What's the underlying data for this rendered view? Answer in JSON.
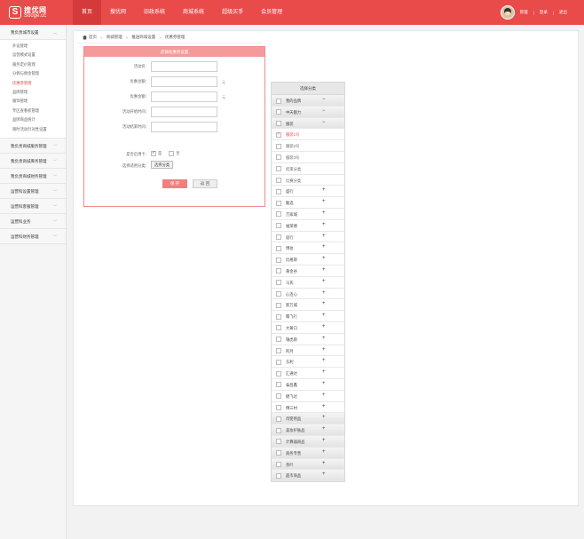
{
  "logo": {
    "mark": "S",
    "title": "搜优网",
    "domain": "Sooge.cc"
  },
  "nav": [
    "首页",
    "搜优网",
    "旧政系统",
    "商城系统",
    "超级买手",
    "会员管理"
  ],
  "user": {
    "name": "管理",
    "links": [
      "登录",
      "退出"
    ]
  },
  "sidebar": {
    "sections": [
      {
        "title": "我负责城市设置",
        "expanded": true,
        "items": [
          "外设管理",
          "运营模式设置",
          "服务定价管理",
          "分佣与佣金管理",
          "优惠券管理",
          "品牌管理",
          "服饰管理",
          "专区查看权管理",
          "品牌商品统计",
          "限时活动针对性设置"
        ]
      },
      {
        "title": "我负责商城服务管理"
      },
      {
        "title": "我负责商城库务管理"
      },
      {
        "title": "我负责商城财务管理"
      },
      {
        "title": "运营科设置管理"
      },
      {
        "title": "运营科客服管理"
      },
      {
        "title": "运营科业务"
      },
      {
        "title": "运营科财务管理"
      }
    ]
  },
  "breadcrumb": [
    "首页",
    "商城管理",
    "推送商城设置",
    "优惠券管理"
  ],
  "form": {
    "header": "店铺优惠券设置",
    "fields": [
      {
        "label": "活动名：",
        "value": "",
        "unit": ""
      },
      {
        "label": "优惠总额：",
        "value": "",
        "unit": "元"
      },
      {
        "label": "优惠金额：",
        "value": "",
        "unit": "元"
      },
      {
        "label": "活动开始时间：",
        "value": "",
        "unit": ""
      },
      {
        "label": "活动结束时间：",
        "value": "",
        "unit": ""
      }
    ],
    "online": {
      "label": "是否启用卡：",
      "yes": "是",
      "no": "否",
      "selected": "是"
    },
    "category": {
      "label": "选择适用分类：",
      "button": "选择分类"
    },
    "save": "保 存",
    "back": "返 回"
  },
  "categories": {
    "header": "选择分类",
    "items": [
      {
        "name": "我的品牌",
        "type": "group",
        "toggle": "−",
        "checked": false
      },
      {
        "name": "中天魅力",
        "type": "group",
        "toggle": "−",
        "checked": false
      },
      {
        "name": "服装",
        "type": "group",
        "toggle": "−",
        "checked": false
      },
      {
        "name": "服装1号",
        "type": "child",
        "checked": true
      },
      {
        "name": "服装2号",
        "type": "child",
        "checked": false
      },
      {
        "name": "服装3号",
        "type": "child",
        "checked": false
      },
      {
        "name": "结束分类",
        "type": "child",
        "checked": false
      },
      {
        "name": "比赛分类",
        "type": "child",
        "checked": false
      },
      {
        "name": "盛行",
        "type": "plain",
        "toggle": "+",
        "checked": false
      },
      {
        "name": "甄选",
        "type": "plain",
        "toggle": "+",
        "checked": false
      },
      {
        "name": "万家城",
        "type": "plain",
        "toggle": "+",
        "checked": false
      },
      {
        "name": "福莱德",
        "type": "plain",
        "toggle": "+",
        "checked": false
      },
      {
        "name": "居行",
        "type": "plain",
        "toggle": "+",
        "checked": false
      },
      {
        "name": "博往",
        "type": "plain",
        "toggle": "+",
        "checked": false
      },
      {
        "name": "比格斯",
        "type": "plain",
        "toggle": "+",
        "checked": false
      },
      {
        "name": "黄金谷",
        "type": "plain",
        "toggle": "+",
        "checked": false
      },
      {
        "name": "马氏",
        "type": "plain",
        "toggle": "+",
        "checked": false
      },
      {
        "name": "心连心",
        "type": "plain",
        "toggle": "+",
        "checked": false
      },
      {
        "name": "新万城",
        "type": "plain",
        "toggle": "+",
        "checked": false
      },
      {
        "name": "腾飞行",
        "type": "plain",
        "toggle": "+",
        "checked": false
      },
      {
        "name": "大黄口",
        "type": "plain",
        "toggle": "+",
        "checked": false
      },
      {
        "name": "锦虎斯",
        "type": "plain",
        "toggle": "+",
        "checked": false
      },
      {
        "name": "阿月",
        "type": "plain",
        "toggle": "+",
        "checked": false
      },
      {
        "name": "东利",
        "type": "plain",
        "toggle": "+",
        "checked": false
      },
      {
        "name": "汇通达",
        "type": "plain",
        "toggle": "+",
        "checked": false
      },
      {
        "name": "泰昌鑫",
        "type": "plain",
        "toggle": "+",
        "checked": false
      },
      {
        "name": "捷飞达",
        "type": "plain",
        "toggle": "+",
        "checked": false
      },
      {
        "name": "傅三村",
        "type": "plain",
        "toggle": "+",
        "checked": false
      },
      {
        "name": "母婴用品",
        "type": "group",
        "toggle": "+",
        "checked": false
      },
      {
        "name": "美妆护肤品",
        "type": "group",
        "toggle": "+",
        "checked": false
      },
      {
        "name": "计算器商品",
        "type": "group",
        "toggle": "+",
        "checked": false
      },
      {
        "name": "商务专营",
        "type": "group",
        "toggle": "+",
        "checked": false
      },
      {
        "name": "茶叶",
        "type": "group",
        "toggle": "+",
        "checked": false
      },
      {
        "name": "超市商品",
        "type": "group",
        "toggle": "+",
        "checked": false
      }
    ]
  },
  "colors": {
    "brand": "#e94b4b",
    "active_nav": "#d43a3a",
    "form_header": "#f49a9a"
  }
}
